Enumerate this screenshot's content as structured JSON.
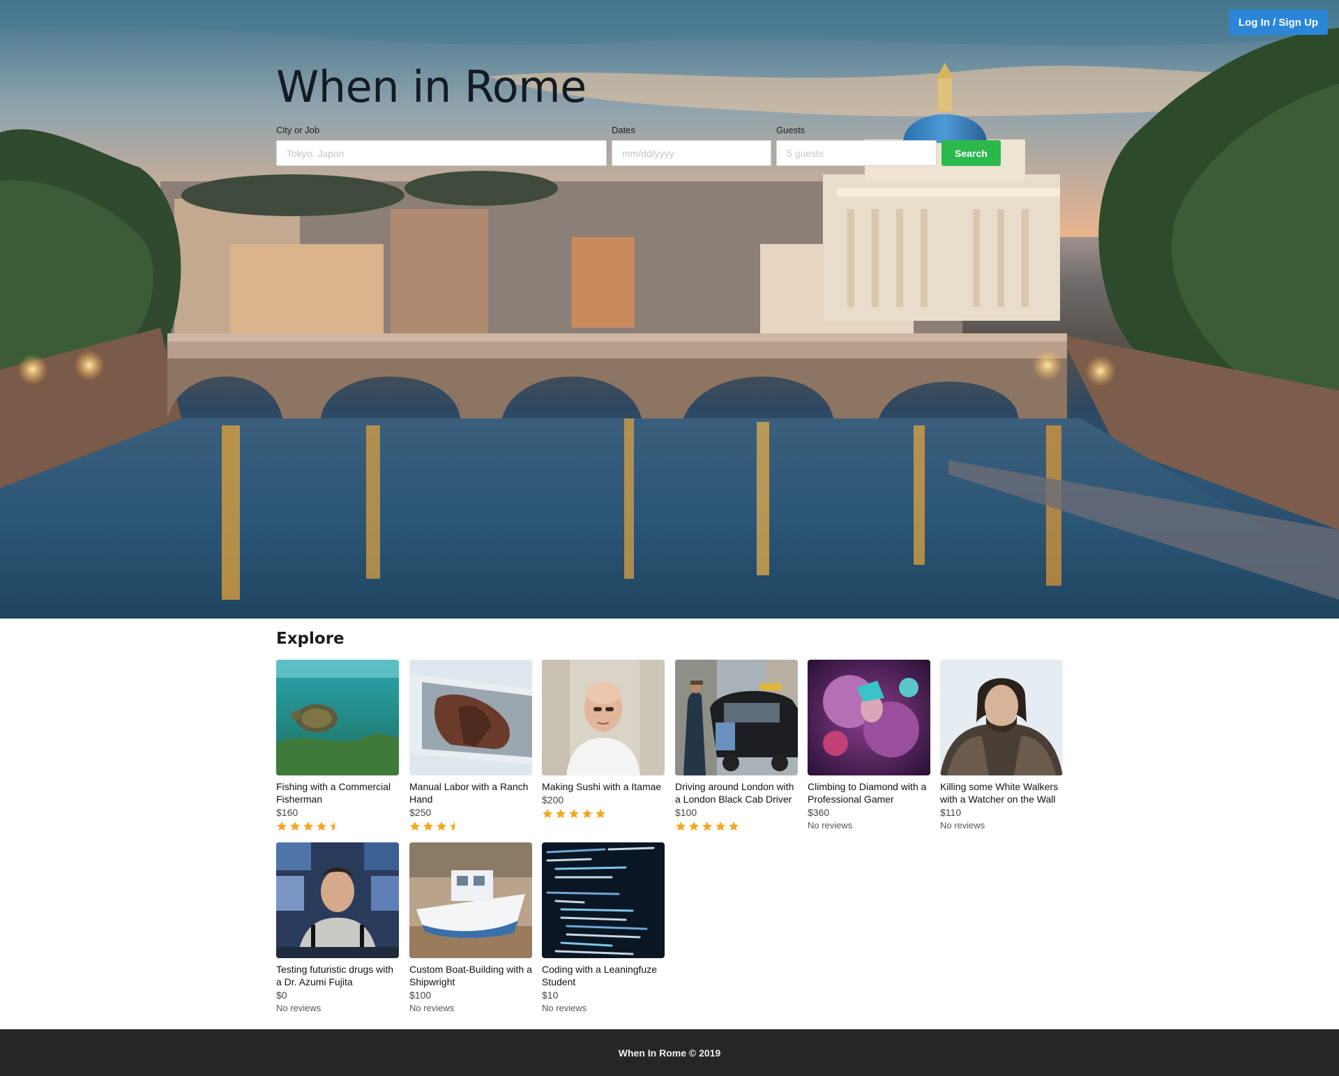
{
  "header": {
    "login_label": "Log In / Sign Up"
  },
  "hero": {
    "title": "When in Rome",
    "fields": {
      "city_label": "City or Job",
      "city_placeholder": "Tokyo, Japan",
      "dates_label": "Dates",
      "dates_placeholder": "mm/dd/yyyy",
      "guests_label": "Guests",
      "guests_placeholder": "5 guests"
    },
    "search_label": "Search"
  },
  "explore": {
    "title": "Explore",
    "cards": [
      {
        "title": "Fishing with a Commercial Fisherman",
        "price": "$160",
        "rating": 4.5,
        "reviews": ""
      },
      {
        "title": "Manual Labor with a Ranch Hand",
        "price": "$250",
        "rating": 3.5,
        "reviews": ""
      },
      {
        "title": "Making Sushi with a Itamae",
        "price": "$200",
        "rating": 5,
        "reviews": ""
      },
      {
        "title": "Driving around London with a London Black Cab Driver",
        "price": "$100",
        "rating": 5,
        "reviews": ""
      },
      {
        "title": "Climbing to Diamond with a Professional Gamer",
        "price": "$360",
        "rating": null,
        "reviews": "No reviews"
      },
      {
        "title": "Killing some White Walkers with a Watcher on the Wall",
        "price": "$110",
        "rating": null,
        "reviews": "No reviews"
      },
      {
        "title": "Testing futuristic drugs with a Dr. Azumi Fujita",
        "price": "$0",
        "rating": null,
        "reviews": "No reviews"
      },
      {
        "title": "Custom Boat-Building with a Shipwright",
        "price": "$100",
        "rating": null,
        "reviews": "No reviews"
      },
      {
        "title": "Coding with a Leaningfuze Student",
        "price": "$10",
        "rating": null,
        "reviews": "No reviews"
      }
    ]
  },
  "footer": {
    "text": "When In Rome © 2019"
  },
  "colors": {
    "primary": "#2b86d8",
    "search": "#2db84d",
    "star": "#f5a623",
    "footer": "#262626"
  }
}
